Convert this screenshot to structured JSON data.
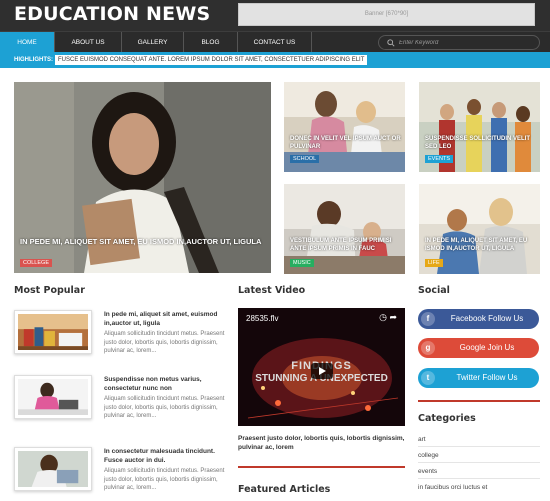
{
  "header": {
    "logo": "EDUCATION NEWS",
    "banner": "Banner [670*90]"
  },
  "nav": {
    "items": [
      "HOME",
      "ABOUT US",
      "GALLERY",
      "BLOG",
      "CONTACT US"
    ],
    "search_placeholder": "Enter Keyword"
  },
  "highlights": {
    "label": "HIGHLIGHTS:",
    "text": "FUSCE EUISMOD CONSEQUAT ANTE. LOREM IPSUM DOLOR SIT AMET, CONSECTETUER ADIPISCING ELIT"
  },
  "featured": [
    {
      "caption": "IN PEDE MI, ALIQUET SIT AMET, EU ISMOD IN,AUCTOR UT, LIGULA",
      "tag": "COLLEGE",
      "tag_color": "#d9534f"
    },
    {
      "caption": "DONEC IN VELIT VEL IPSUM AUCT OR PULVINAR",
      "tag": "SCHOOL",
      "tag_color": "#2a6fa8"
    },
    {
      "caption": "SUSPENDISSE SOLLICITUDIN VELIT SED LEO",
      "tag": "EVENTS",
      "tag_color": "#1da1d4"
    },
    {
      "caption": "VESTIBULUM ANTE IPSUM PRIMISI ANTE IPSUM PRIMIS IN FAUC",
      "tag": "MUSIC",
      "tag_color": "#27ae60"
    },
    {
      "caption": "IN PEDE MI, ALIQUET SIT AMET, EU ISMOD IN,AUCTOR UT, LIGULA",
      "tag": "LIFE",
      "tag_color": "#e6a817"
    }
  ],
  "most_popular": {
    "title": "Most Popular",
    "items": [
      {
        "title": "In pede mi, aliquet sit amet, euismod in,auctor ut, ligula",
        "excerpt": "Aliquam sollicitudin tincidunt metus. Praesent justo dolor, lobortis quis, lobortis dignissim, pulvinar ac, lorem..."
      },
      {
        "title": "Suspendisse non metus varius, consectetur nunc non",
        "excerpt": "Aliquam sollicitudin tincidunt metus. Praesent justo dolor, lobortis quis, lobortis dignissim, pulvinar ac, lorem..."
      },
      {
        "title": "In consectetur malesuada tincidunt. Fusce auctor in dui.",
        "excerpt": "Aliquam sollicitudin tincidunt metus. Praesent justo dolor, lobortis quis, lobortis dignissim, pulvinar ac, lorem..."
      }
    ]
  },
  "latest_video": {
    "title": "Latest Video",
    "file": "28535.flv",
    "overlay_line1": "FINDINGS",
    "overlay_line2": "STUNNING A    UNEXPECTED",
    "caption": "Praesent justo dolor, lobortis quis, lobortis dignissim, pulvinar ac, lorem"
  },
  "featured_articles": {
    "title": "Featured Articles"
  },
  "social": {
    "title": "Social",
    "buttons": [
      {
        "label": "Facebook Follow Us",
        "icon": "f",
        "color": "#3b5998"
      },
      {
        "label": "Google Join Us",
        "icon": "g",
        "color": "#dd4b39"
      },
      {
        "label": "Twitter Follow Us",
        "icon": "t",
        "color": "#1da1d4"
      }
    ]
  },
  "categories": {
    "title": "Categories",
    "items": [
      "art",
      "college",
      "events",
      "in faucibus orci luctus et"
    ]
  }
}
